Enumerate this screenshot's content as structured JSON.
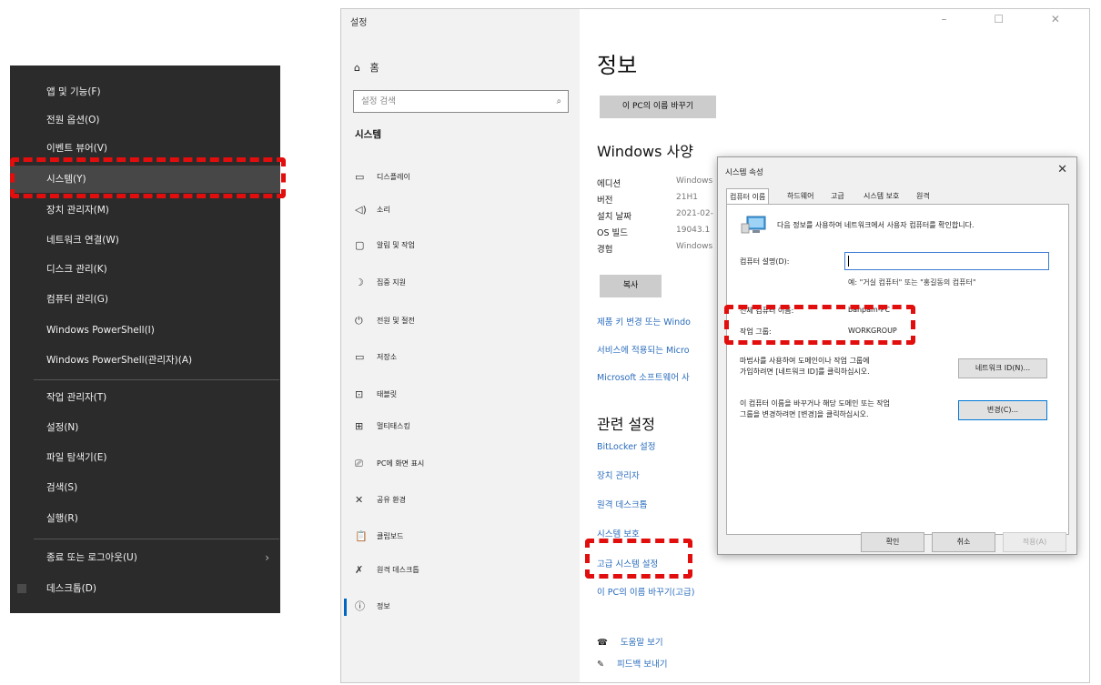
{
  "context_menu": {
    "items": [
      {
        "label": "앱 및 기능(F)"
      },
      {
        "label": "전원 옵션(O)"
      },
      {
        "label": "이벤트 뷰어(V)"
      },
      {
        "label": "시스템(Y)"
      },
      {
        "label": "장치 관리자(M)"
      },
      {
        "label": "네트워크 연결(W)"
      },
      {
        "label": "디스크 관리(K)"
      },
      {
        "label": "컴퓨터 관리(G)"
      },
      {
        "label": "Windows PowerShell(I)"
      },
      {
        "label": "Windows PowerShell(관리자)(A)"
      },
      {
        "label": "작업 관리자(T)"
      },
      {
        "label": "설정(N)"
      },
      {
        "label": "파일 탐색기(E)"
      },
      {
        "label": "검색(S)"
      },
      {
        "label": "실행(R)"
      },
      {
        "label": "종료 또는 로그아웃(U)"
      },
      {
        "label": "데스크톱(D)"
      }
    ],
    "submenu_arrow": "›"
  },
  "settings": {
    "window_title": "설정",
    "window_controls": "–  ☐  ✕",
    "home": {
      "icon": "⌂",
      "label": "홈"
    },
    "search": {
      "placeholder": "설정 검색",
      "icon": "⌕"
    },
    "section_label": "시스템",
    "nav_items": [
      {
        "icon": "▭",
        "label": "디스플레이"
      },
      {
        "icon": "◁)",
        "label": "소리"
      },
      {
        "icon": "▢",
        "label": "알림 및 작업"
      },
      {
        "icon": "☽",
        "label": "집중 지원"
      },
      {
        "icon": "⏻",
        "label": "전원 및 절전"
      },
      {
        "icon": "▭",
        "label": "저장소"
      },
      {
        "icon": "⊡",
        "label": "태블릿"
      },
      {
        "icon": "⊞",
        "label": "멀티태스킹"
      },
      {
        "icon": "⎚",
        "label": "PC에 화면 표시"
      },
      {
        "icon": "✕",
        "label": "공유 환경"
      },
      {
        "icon": "📋",
        "label": "클립보드"
      },
      {
        "icon": "✗",
        "label": "원격 데스크톱"
      },
      {
        "icon": "ⓘ",
        "label": "정보"
      }
    ],
    "content": {
      "title": "정보",
      "rename_button": "이 PC의 이름 바꾸기",
      "windows_spec_heading": "Windows 사양",
      "specs": [
        {
          "label": "에디션",
          "value": "Windows"
        },
        {
          "label": "버전",
          "value": "21H1"
        },
        {
          "label": "설치 날짜",
          "value": "2021-02-"
        },
        {
          "label": "OS 빌드",
          "value": "19043.1"
        },
        {
          "label": "경험",
          "value": "Windows"
        }
      ],
      "copy_button": "복사",
      "links_top": [
        "제품 키 변경 또는 Windo",
        "서비스에 적용되는 Micro",
        "Microsoft 소프트웨어 사"
      ],
      "related_heading": "관련 설정",
      "related_links": [
        "BitLocker 설정",
        "장치 관리자",
        "원격 데스크톱",
        "시스템 보호",
        "고급 시스템 설정",
        "이 PC의 이름 바꾸기(고급)"
      ],
      "help": [
        {
          "icon": "☎",
          "label": "도움말 보기"
        },
        {
          "icon": "✎",
          "label": "피드백 보내기"
        }
      ]
    }
  },
  "dialog": {
    "title": "시스템 속성",
    "close": "✕",
    "tabs": [
      "컴퓨터 이름",
      "하드웨어",
      "고급",
      "시스템 보호",
      "원격"
    ],
    "description": "다음 정보를 사용하여 네트워크에서 사용자 컴퓨터를 확인합니다.",
    "computer_description_label": "컴퓨터 설명(D):",
    "computer_description_value": "",
    "example_text": "예: \"거실 컴퓨터\" 또는 \"홍길동의 컴퓨터\"",
    "full_name_label": "전체 컴퓨터 이름:",
    "full_name_value": "banpam-PC",
    "workgroup_label": "작업 그룹:",
    "workgroup_value": "WORKGROUP",
    "network_id_text_1": "마법사를 사용하여 도메인이나 작업 그룹에",
    "network_id_text_2": "가입하려면 [네트워크 ID]를 클릭하십시오.",
    "network_id_button": "네트워크 ID(N)...",
    "change_text_1": "이 컴퓨터 이름을 바꾸거나 해당 도메인 또는 작업",
    "change_text_2": "그룹을 변경하려면 [변경]을 클릭하십시오.",
    "change_button": "변경(C)...",
    "ok_button": "확인",
    "cancel_button": "취소",
    "apply_button": "적용(A)"
  },
  "colors": {
    "highlight": "#e20d0d",
    "link": "#2a6cbd",
    "menu_bg": "#2b2b2b"
  }
}
